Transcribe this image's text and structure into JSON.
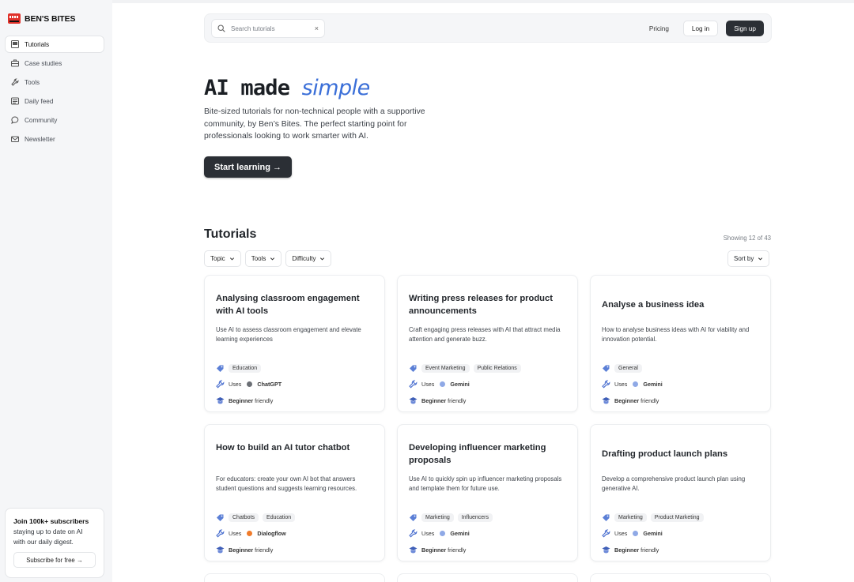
{
  "brand": {
    "name": "BEN'S BITES"
  },
  "sidebar": {
    "items": [
      {
        "label": "Tutorials",
        "icon": "tutorials-icon",
        "active": true
      },
      {
        "label": "Case studies",
        "icon": "briefcase-icon",
        "active": false
      },
      {
        "label": "Tools",
        "icon": "wrench-icon",
        "active": false
      },
      {
        "label": "Daily feed",
        "icon": "newspaper-icon",
        "active": false
      },
      {
        "label": "Community",
        "icon": "chat-bubble-icon",
        "active": false
      },
      {
        "label": "Newsletter",
        "icon": "mail-icon",
        "active": false
      }
    ],
    "subscribe": {
      "title": "Join 100k+ subscribers",
      "text": "staying up to date on AI with our daily digest.",
      "button": "Subscribe for free →"
    }
  },
  "header": {
    "search_placeholder": "Search tutorials",
    "clear": "×",
    "pricing": "Pricing",
    "login": "Log in",
    "signup": "Sign up"
  },
  "hero": {
    "title_main": "AI made ",
    "title_accent": "simple",
    "description": "Bite-sized tutorials for non-technical people with a supportive community, by Ben’s Bites. The perfect starting point for professionals looking to work smarter with AI.",
    "cta": "Start learning →"
  },
  "tutorials": {
    "heading": "Tutorials",
    "showing": "Showing 12 of 43",
    "filters": [
      "Topic",
      "Tools",
      "Difficulty"
    ],
    "sort": "Sort by",
    "uses_label": "Uses",
    "level_bold": "Beginner",
    "level_rest": " friendly",
    "cards": [
      {
        "title": "Analysing classroom engagement with AI tools",
        "description": "Use AI to assess classroom engagement and elevate learning experiences",
        "tags": [
          "Education"
        ],
        "tool": "ChatGPT",
        "tool_color": "#6b6f75"
      },
      {
        "title": "Writing press releases for product announcements",
        "description": "Craft engaging press releases with AI that attract media attention and generate buzz.",
        "tags": [
          "Event Marketing",
          "Public Relations"
        ],
        "tool": "Gemini",
        "tool_color": "#8fa9e6"
      },
      {
        "title": "Analyse a business idea",
        "description": "How to analyse business ideas with AI for viability and innovation potential.",
        "tags": [
          "General"
        ],
        "tool": "Gemini",
        "tool_color": "#8fa9e6"
      },
      {
        "title": "How to build an AI tutor chatbot",
        "description": "For educators: create your own AI bot that answers student questions and suggests learning resources.",
        "tags": [
          "Chatbots",
          "Education"
        ],
        "tool": "Dialogflow",
        "tool_color": "#f07b2a"
      },
      {
        "title": "Developing influencer marketing proposals",
        "description": "Use AI to quickly spin up influencer marketing proposals and template them for future use.",
        "tags": [
          "Marketing",
          "Influencers"
        ],
        "tool": "Gemini",
        "tool_color": "#8fa9e6"
      },
      {
        "title": "Drafting product launch plans",
        "description": "Develop a comprehensive product launch plan using generative AI.",
        "tags": [
          "Marketing",
          "Product Marketing"
        ],
        "tool": "Gemini",
        "tool_color": "#8fa9e6"
      }
    ]
  }
}
